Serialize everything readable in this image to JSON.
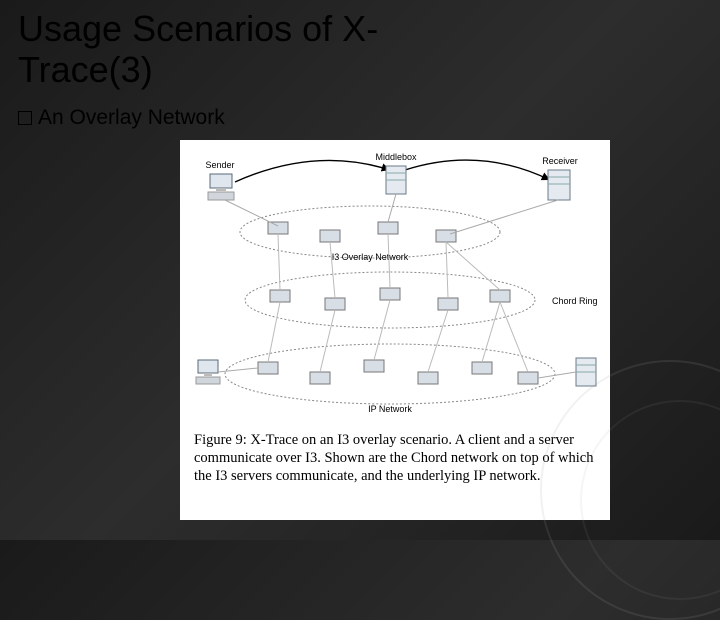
{
  "title_line1": "Usage Scenarios of X-",
  "title_line2": "Trace(3)",
  "bullet_label": "An Overlay Network",
  "labels": {
    "sender": "Sender",
    "middlebox": "Middlebox",
    "receiver": "Receiver",
    "i3": "I3 Overlay Network",
    "chord": "Chord Ring",
    "ip": "IP Network"
  },
  "caption": "Figure 9: X-Trace on an I3 overlay scenario. A client and a server communicate over I3. Shown are the Chord network on top of which the I3 servers communicate, and the underlying IP network."
}
